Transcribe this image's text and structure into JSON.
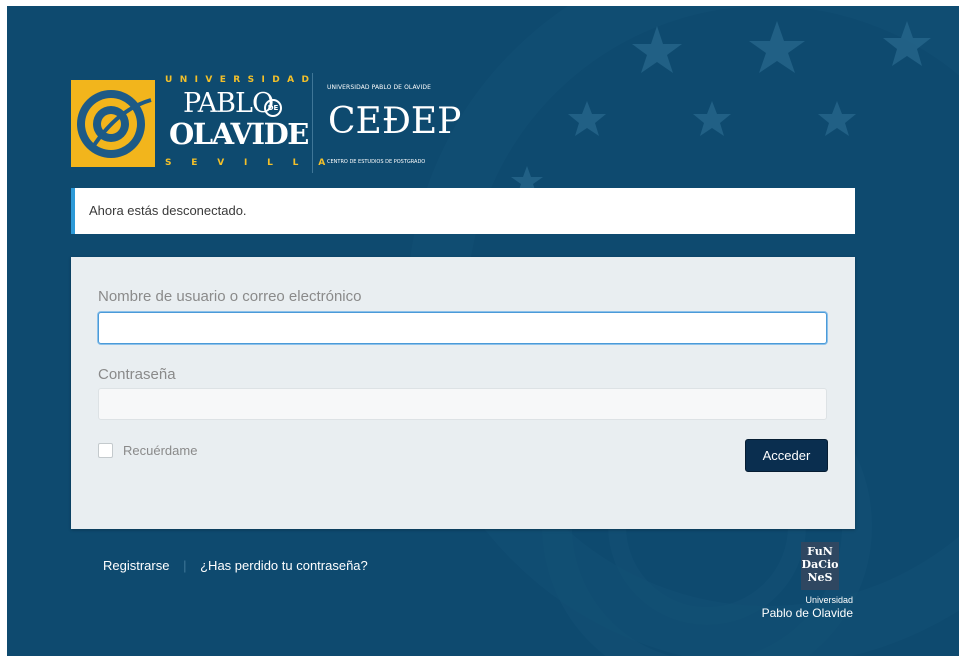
{
  "logos": {
    "upo": {
      "line_top": "UNIVERSIDAD",
      "line_pablo": "PABLO",
      "line_de": "DE",
      "line_olavide": "OLAVIDE",
      "line_bottom": "SEVILLA"
    },
    "cedep": {
      "top": "UNIVERSIDAD PABLO DE OLAVIDE",
      "name": "CEÐEP",
      "bottom": "CENTRO DE ESTUDIOS DE POSTGRADO"
    }
  },
  "message": "Ahora estás desconectado.",
  "form": {
    "username_label": "Nombre de usuario o correo electrónico",
    "username_value": "",
    "password_label": "Contraseña",
    "password_value": "",
    "remember_label": "Recuérdame",
    "remember_checked": false,
    "submit_label": "Acceder"
  },
  "nav": {
    "register": "Registrarse",
    "separator": "|",
    "lost_password": "¿Has perdido tu contraseña?"
  },
  "footer_logo": {
    "box_line1": "FuN",
    "box_line2": "DaCio",
    "box_line3": "NeS",
    "line1": "Universidad",
    "line2": "Pablo de Olavide"
  },
  "colors": {
    "background": "#0e4a6f",
    "accent_gold": "#f2b51c",
    "message_border": "#2d9ad8",
    "button": "#0a2e4f"
  }
}
